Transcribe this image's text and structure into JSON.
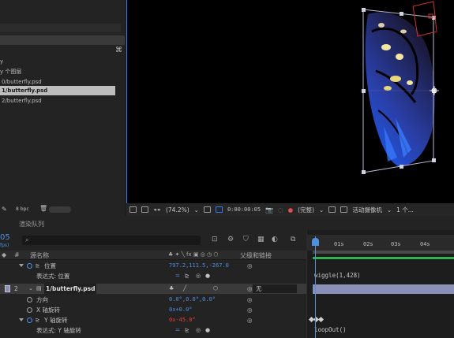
{
  "project": {
    "items": [
      {
        "label": "y"
      },
      {
        "label": "y 个图层"
      },
      {
        "label": "0/butterfly.psd"
      },
      {
        "label": "1/butterfly.psd"
      },
      {
        "label": "2/butterfly.psd"
      }
    ],
    "bpc": "8 bpc"
  },
  "viewer_footer": {
    "zoom": "(74.2%)",
    "timecode": "0:00:00:05",
    "resolution": "(完整)",
    "camera": "活动摄像机",
    "views": "1 个..."
  },
  "timeline": {
    "tab": "渲染队列",
    "timecode": "05",
    "timecode_sub": "fps)",
    "search_icon": "search-icon",
    "columns": {
      "num": "#",
      "name": "源名称",
      "parent": "父级和链接"
    },
    "ruler": [
      "01s",
      "02s",
      "03s",
      "04s"
    ],
    "rows": {
      "position": {
        "label": "位置",
        "value": "797.2,111.5,-267.0"
      },
      "position_expr": {
        "label": "表达式: 位置"
      },
      "layer": {
        "num": "2",
        "name": "1/butterfly.psd",
        "parent": "无"
      },
      "orientation": {
        "label": "方向",
        "value": "0.0°,0.0°,0.0°"
      },
      "xrot": {
        "label": "X 轴旋转",
        "value": "0x+0.0°"
      },
      "yrot": {
        "label": "Y 轴旋转",
        "value": "0x-45.0°"
      },
      "yrot_expr": {
        "label": "表达式: Y 轴旋转"
      }
    },
    "expressions": {
      "wiggle": "wiggle(1,428)",
      "loop": "loopOut()"
    }
  },
  "colors": {
    "accent": "#4f8fe0",
    "keyframe_red": "#e0443a",
    "selection": "#bdbdbd"
  }
}
